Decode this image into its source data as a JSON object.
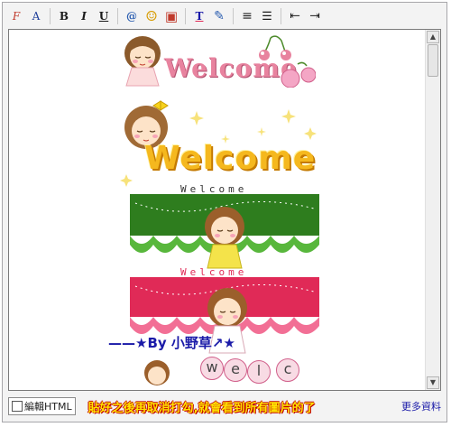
{
  "toolbar": {
    "buttons": [
      {
        "name": "font-family-button",
        "glyph": "F"
      },
      {
        "name": "font-size-button",
        "glyph": "A"
      },
      {
        "name": "bold-button",
        "glyph": "B"
      },
      {
        "name": "italic-button",
        "glyph": "I"
      },
      {
        "name": "underline-button",
        "glyph": "U"
      },
      {
        "name": "hyperlink-button",
        "glyph": "@"
      },
      {
        "name": "emoticon-button",
        "glyph": "☺"
      },
      {
        "name": "insert-image-button",
        "glyph": "▣"
      },
      {
        "name": "text-color-button",
        "glyph": "T"
      },
      {
        "name": "highlight-button",
        "glyph": "✎"
      },
      {
        "name": "align-button",
        "glyph": "≡"
      },
      {
        "name": "list-button",
        "glyph": "☰"
      },
      {
        "name": "outdent-button",
        "glyph": "⇤"
      },
      {
        "name": "indent-button",
        "glyph": "⇥"
      }
    ]
  },
  "editor": {
    "banner1_text": "Welcome",
    "banner2_text": "Welcome",
    "banner3_text": "Welcome",
    "banner4_text": "Welcome",
    "signature": "——★By 小野草↗★",
    "bubble_letters": [
      "w",
      "e",
      "l",
      "c"
    ]
  },
  "footer": {
    "html_toggle_label": "編輯HTML",
    "notice": "貼好之後再取消打勾,就會看到所有圖片的了",
    "more_link": "更多資料"
  },
  "colors": {
    "green_dark": "#2e7d1e",
    "green_light": "#58b73c",
    "pink_dark": "#e02a57",
    "pink_light": "#f26f95",
    "gold": "#f5b81e"
  }
}
